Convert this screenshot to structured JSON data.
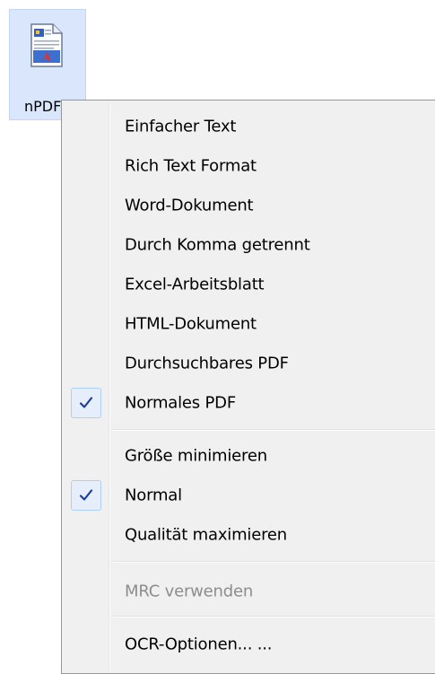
{
  "desktop_icon": {
    "label": "nPDF",
    "icon": "pdf-document-icon"
  },
  "context_menu": {
    "items": [
      {
        "label": "Einfacher Text",
        "checked": false,
        "disabled": false
      },
      {
        "label": "Rich Text Format",
        "checked": false,
        "disabled": false
      },
      {
        "label": "Word-Dokument",
        "checked": false,
        "disabled": false
      },
      {
        "label": "Durch Komma getrennt",
        "checked": false,
        "disabled": false
      },
      {
        "label": "Excel-Arbeitsblatt",
        "checked": false,
        "disabled": false
      },
      {
        "label": "HTML-Dokument",
        "checked": false,
        "disabled": false
      },
      {
        "label": "Durchsuchbares PDF",
        "checked": false,
        "disabled": false
      },
      {
        "label": "Normales PDF",
        "checked": true,
        "disabled": false
      },
      {
        "label": "Größe minimieren",
        "checked": false,
        "disabled": false
      },
      {
        "label": "Normal",
        "checked": true,
        "disabled": false
      },
      {
        "label": "Qualität maximieren",
        "checked": false,
        "disabled": false
      },
      {
        "label": "MRC verwenden",
        "checked": false,
        "disabled": true
      },
      {
        "label": "OCR-Optionen... ...",
        "checked": false,
        "disabled": false
      }
    ],
    "check_icon": "checkmark-icon",
    "colors": {
      "check": "#1d3e9b",
      "disabled_text": "#8d8d8d"
    }
  }
}
